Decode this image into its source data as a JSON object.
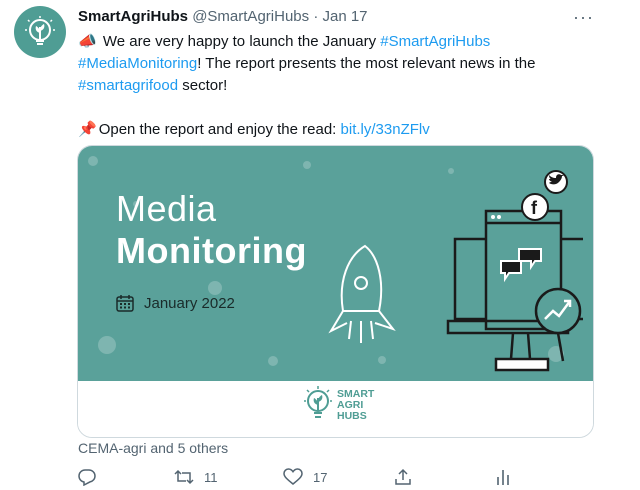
{
  "tweet": {
    "display_name": "SmartAgriHubs",
    "handle": "@SmartAgriHubs",
    "separator": "·",
    "date": "Jan 17",
    "more_glyph": "···",
    "line1_emoji": "📣",
    "line1_text": "We are very happy to launch the January",
    "hashtag1": "#SmartAgriHubs",
    "hashtag2": "#MediaMonitoring",
    "line2_text": "! The report presents the most relevant news in the",
    "hashtag3": "#smartagrifood",
    "line3_text": "sector!",
    "line4_emoji": "📌",
    "line4_text": "Open the report and enjoy the read:",
    "link": "bit.ly/33nZFlv"
  },
  "card": {
    "title_light": "Media",
    "title_bold": "Monitoring",
    "date": "January 2022",
    "logo_lines": [
      "SMART",
      "AGRI",
      "HUBS"
    ],
    "colors": {
      "teal": "#5aa19a",
      "logo": "#4f9d94"
    }
  },
  "social_context": "CEMA-agri and 5 others",
  "actions": {
    "retweets": "11",
    "likes": "17"
  },
  "icons": [
    "reply-icon",
    "retweet-icon",
    "like-icon",
    "share-icon",
    "analytics-icon",
    "twitter-bird-icon",
    "facebook-icon",
    "rocket-icon",
    "monitor-icon",
    "magnifier-icon",
    "calendar-icon"
  ]
}
